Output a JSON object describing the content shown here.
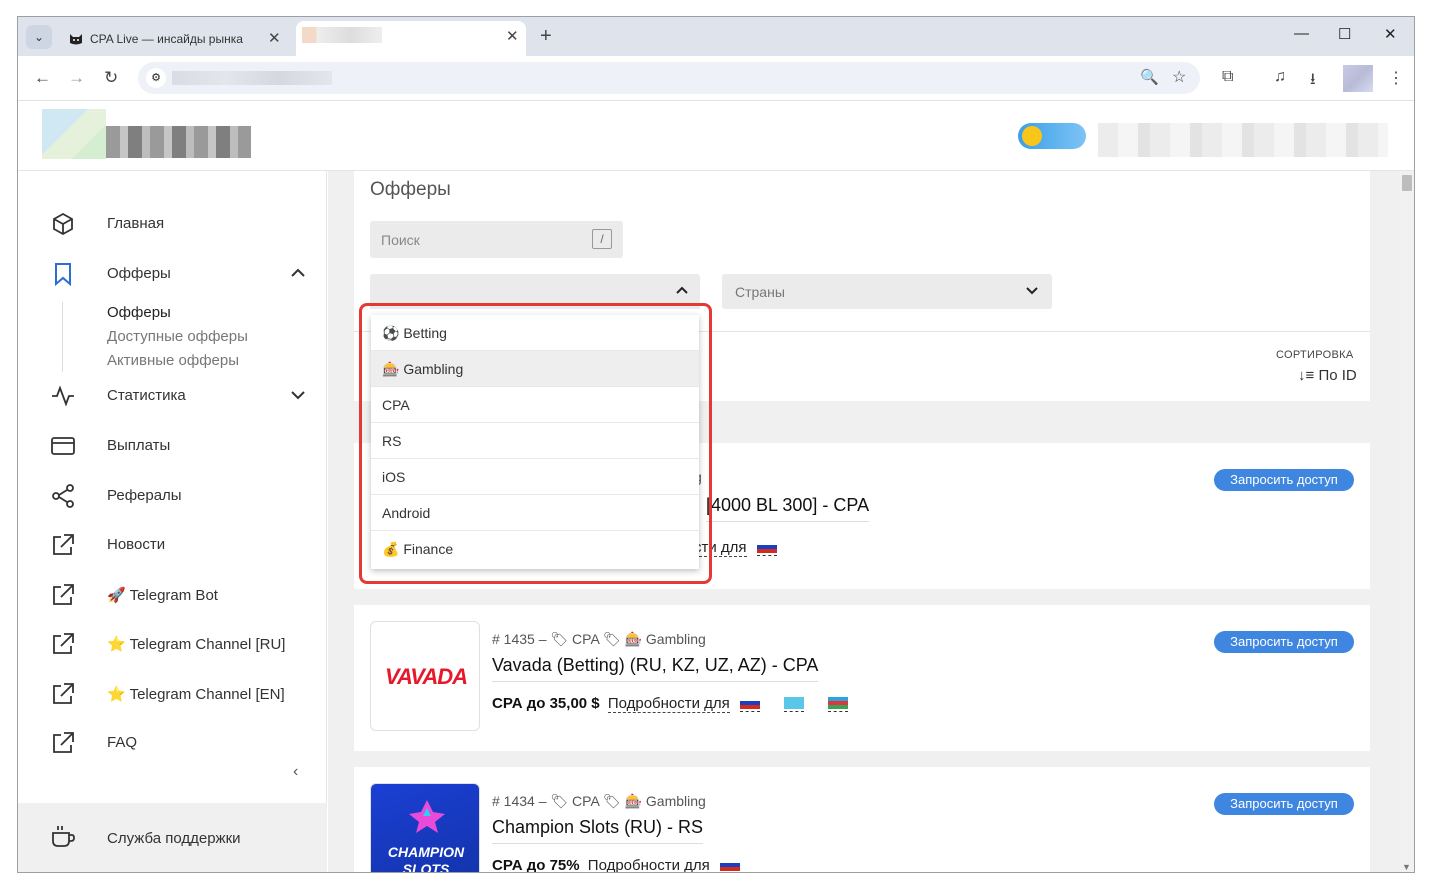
{
  "browser": {
    "tabs": [
      {
        "title": "CPA Live — инсайды рынка",
        "close": "✕"
      },
      {
        "title": "",
        "close": "✕"
      }
    ],
    "tab_menu": "⌄",
    "new_tab": "+",
    "window_controls": {
      "minimize": "—",
      "maximize": "☐",
      "close": "✕"
    },
    "nav": {
      "back": "←",
      "forward": "→",
      "reload": "↻"
    }
  },
  "sidebar": {
    "items": [
      {
        "label": "Главная",
        "icon": "cube-icon"
      },
      {
        "label": "Офферы",
        "icon": "bookmark-icon"
      },
      {
        "label": "Статистика",
        "icon": "activity-icon"
      },
      {
        "label": "Выплаты",
        "icon": "card-icon"
      },
      {
        "label": "Рефералы",
        "icon": "share-icon"
      },
      {
        "label": "Новости",
        "icon": "external-link-icon"
      },
      {
        "label": "🚀 Telegram Bot",
        "icon": "external-link-icon"
      },
      {
        "label": "⭐ Telegram Channel [RU]",
        "icon": "external-link-icon"
      },
      {
        "label": "⭐ Telegram Channel [EN]",
        "icon": "external-link-icon"
      },
      {
        "label": "FAQ",
        "icon": "external-link-icon"
      }
    ],
    "subitems": [
      "Офферы",
      "Доступные офферы",
      "Активные офферы"
    ],
    "collapse": "‹",
    "support": "Служба поддержки"
  },
  "offers": {
    "title": "Офферы",
    "search_placeholder": "Поиск",
    "search_shortcut": "/",
    "countries_placeholder": "Страны",
    "sort_label": "СОРТИРОВКА",
    "sort_value": "По ID",
    "dropdown_options": [
      "⚽ Betting",
      "🎰 Gambling",
      "CPA",
      "RS",
      "iOS",
      "Android",
      "💰 Finance"
    ]
  },
  "cards": [
    {
      "meta": "g",
      "name": "[4000 BL 300] - CPA",
      "price_prefix": "",
      "price_value": "",
      "details": "сти для",
      "request": "Запросить доступ"
    },
    {
      "meta": "# 1435 –  🏷 CPA   🏷 🎰 Gambling",
      "name": "Vavada (Betting) (RU, KZ, UZ, AZ) - CPA",
      "price_prefix": "CPA",
      "price_value": "до 35,00 $",
      "details": "Подробности для",
      "request": "Запросить доступ",
      "logo_text": "VAVADA"
    },
    {
      "meta": "# 1434 –  🏷 CPA   🏷 🎰 Gambling",
      "name": "Champion Slots (RU) - RS",
      "price_prefix": "CPA",
      "price_value": "до 75%",
      "details": "Подробности для",
      "request": "Запросить доступ",
      "logo_text": "CHAMPION SLOTS"
    }
  ],
  "colors": {
    "accent": "#3f86e0",
    "highlight": "#e53935"
  }
}
